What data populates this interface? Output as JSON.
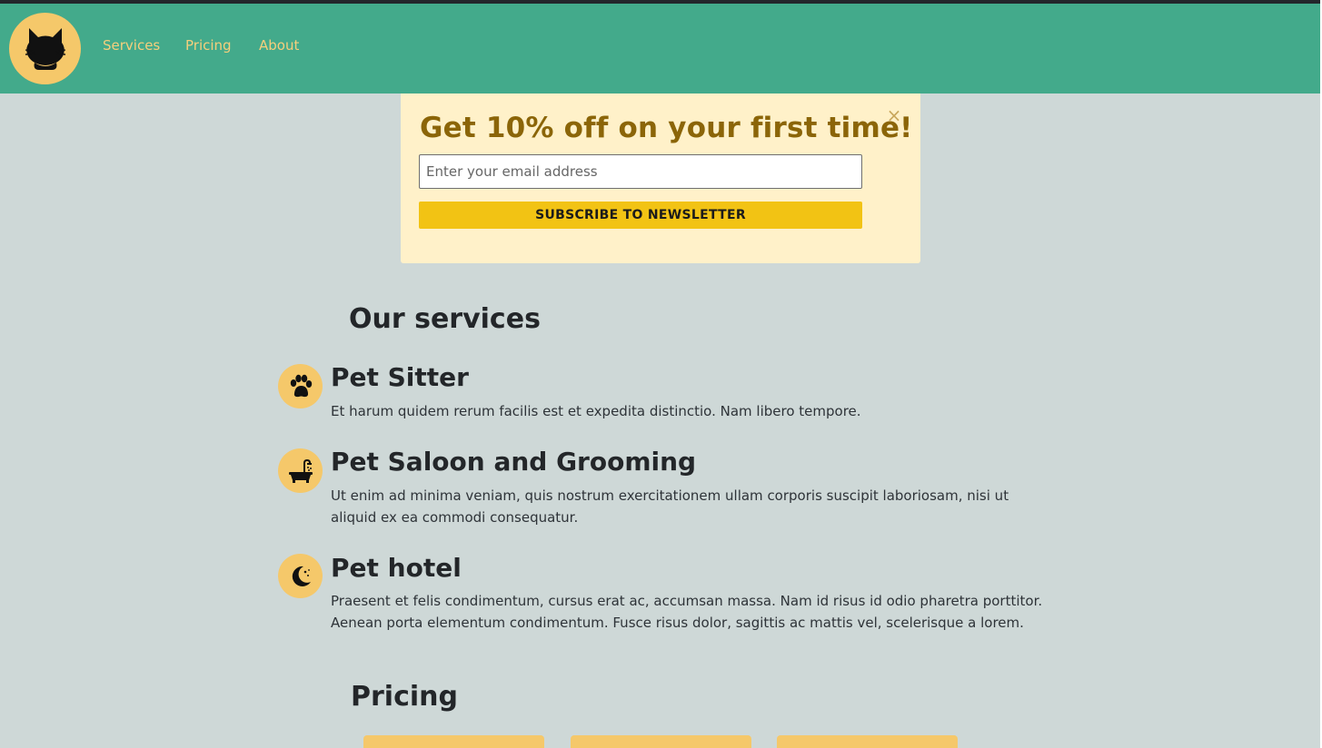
{
  "nav": {
    "logo_icon": "cat-icon",
    "links": [
      "Services",
      "Pricing",
      "About"
    ]
  },
  "popup": {
    "title": "Get 10% off on your first time!",
    "close_glyph": "×",
    "email_placeholder": "Enter your email address",
    "email_value": "",
    "subscribe_label": "SUBSCRIBE TO NEWSLETTER"
  },
  "services": {
    "heading": "Our services",
    "items": [
      {
        "icon": "paw-icon",
        "name": "Pet Sitter",
        "description": "Et harum quidem rerum facilis est et expedita distinctio. Nam libero tempore."
      },
      {
        "icon": "bathtub-icon",
        "name": "Pet Saloon and Grooming",
        "description": "Ut enim ad minima veniam, quis nostrum exercitationem ullam corporis suscipit laboriosam, nisi ut aliquid ex ea commodi consequatur."
      },
      {
        "icon": "moon-icon",
        "name": "Pet hotel",
        "description": "Praesent et felis condimentum, cursus erat ac, accumsan massa. Nam id risus id odio pharetra porttitor. Aenean porta elementum condimentum. Fusce risus dolor, sagittis ac mattis vel, scelerisque a lorem."
      }
    ]
  },
  "pricing": {
    "heading": "Pricing"
  },
  "colors": {
    "navbar": "#43aa8b",
    "accent_yellow": "#f5c86a",
    "popup_bg": "#fff1c9",
    "button_yellow": "#f2c314",
    "page_bg": "#ced8d7"
  }
}
